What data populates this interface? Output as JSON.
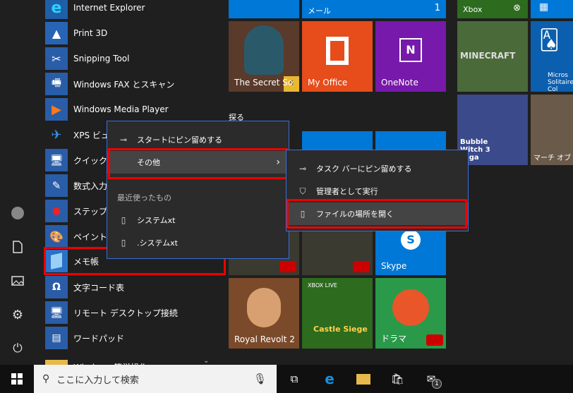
{
  "apps": [
    {
      "label": "Internet Explorer",
      "icon": "internet-explorer-icon"
    },
    {
      "label": "Print 3D",
      "icon": "print-3d-icon"
    },
    {
      "label": "Snipping Tool",
      "icon": "snipping-tool-icon"
    },
    {
      "label": "Windows FAX とスキャン",
      "icon": "fax-icon"
    },
    {
      "label": "Windows Media Player",
      "icon": "media-player-icon"
    },
    {
      "label": "XPS ビュ",
      "icon": "xps-viewer-icon"
    },
    {
      "label": "クイック",
      "icon": "quick-assist-icon"
    },
    {
      "label": "数式入力",
      "icon": "math-input-icon"
    },
    {
      "label": "ステップ記",
      "icon": "steps-recorder-icon"
    },
    {
      "label": "ペイント",
      "icon": "paint-icon"
    },
    {
      "label": "メモ帳",
      "icon": "notepad-icon"
    },
    {
      "label": "文字コード表",
      "icon": "character-map-icon"
    },
    {
      "label": "リモート デスクトップ接続",
      "icon": "remote-desktop-icon"
    },
    {
      "label": "ワードパッド",
      "icon": "wordpad-icon"
    },
    {
      "label": "Windows 簡単操作",
      "icon": "folder-icon"
    }
  ],
  "tiles": {
    "mail_label": "メール",
    "mail_count": "1",
    "xbox_label": "Xbox",
    "secret_label": "The Secret So",
    "myoffice_label": "My Office",
    "onenote_label": "OneNote",
    "minecraft_label": "MINECRAFT",
    "solitaire_label": "Micros Solitaire Col",
    "explore_header": "探る",
    "bubble_label": "Bubble Witch 3 saga",
    "march_label": "マーチ オブ",
    "skype_label": "Skype",
    "xbox_live_label": "XBOX LIVE",
    "castle_label": "Castle Siege",
    "royal_label": "Royal Revolt 2",
    "dragon_label": "ドラマ"
  },
  "menu1": {
    "pin_start": "スタートにピン留めする",
    "more": "その他",
    "recent_header": "最近使ったもの",
    "recent": [
      "システムxt",
      ".システムxt"
    ]
  },
  "menu2": {
    "pin_taskbar": "タスク バーにピン留めする",
    "run_admin": "管理者として実行",
    "open_location": "ファイルの場所を開く"
  },
  "taskbar": {
    "search_placeholder": "ここに入力して検索",
    "mail_badge": "1"
  },
  "colors": {
    "accent_blue": "#0078d7",
    "office_orange": "#e74c1b",
    "onenote_purple": "#7719aa",
    "highlight_red": "#e00000"
  }
}
